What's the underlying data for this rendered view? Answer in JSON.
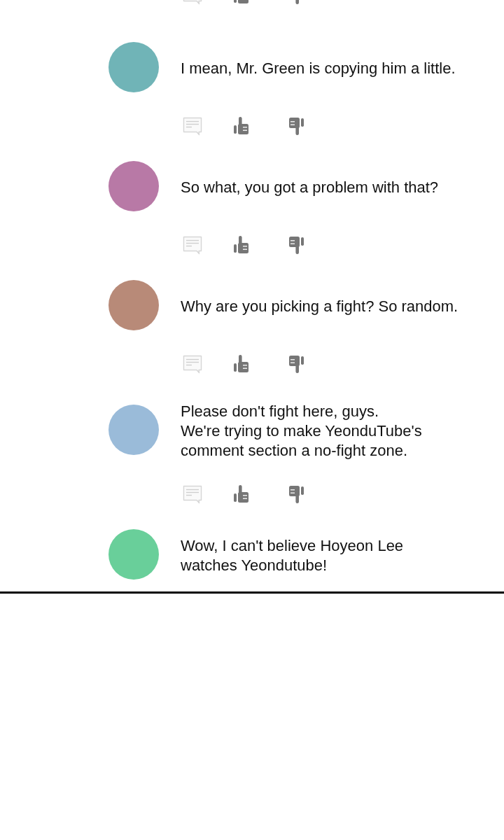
{
  "comment_feed": {
    "items": [
      {
        "kind": "actions"
      },
      {
        "kind": "comment",
        "color": "#70b4b7",
        "text": "I mean, Mr. Green is copying him a little."
      },
      {
        "kind": "actions"
      },
      {
        "kind": "comment",
        "color": "#b879a6",
        "text": "So what, you got a problem with that?"
      },
      {
        "kind": "actions"
      },
      {
        "kind": "comment",
        "color": "#b88a78",
        "text": "Why are you picking a fight? So random."
      },
      {
        "kind": "actions"
      },
      {
        "kind": "comment",
        "color": "#9abbd9",
        "text": "Please don't fight here, guys.\nWe're trying to make YeonduTube's\ncomment section a no-fight zone."
      },
      {
        "kind": "actions"
      },
      {
        "kind": "comment",
        "color": "#69cf9a",
        "text": "Wow, I can't believe Hoyeon Lee\nwatches Yeondutube!"
      }
    ]
  }
}
